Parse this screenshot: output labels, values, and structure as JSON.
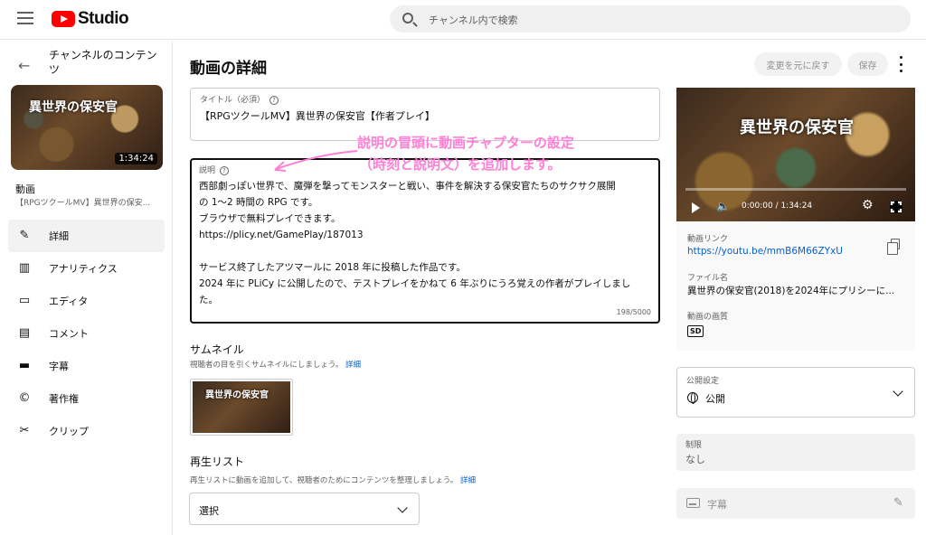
{
  "app": {
    "logo_text": "Studio"
  },
  "search": {
    "placeholder": "チャンネル内で検索"
  },
  "sidebar": {
    "title": "チャンネルのコンテンツ",
    "thumb_title": "異世界の保安官",
    "thumb_duration": "1:34:24",
    "video_label": "動画",
    "video_name": "【RPGツクールMV】異世界の保安...",
    "items": [
      {
        "label": "詳細",
        "icon": "pencil-icon",
        "glyph": "✎"
      },
      {
        "label": "アナリティクス",
        "icon": "analytics-icon",
        "glyph": "▥"
      },
      {
        "label": "エディタ",
        "icon": "editor-icon",
        "glyph": "▭"
      },
      {
        "label": "コメント",
        "icon": "comment-icon",
        "glyph": "▤"
      },
      {
        "label": "字幕",
        "icon": "subtitles-icon",
        "glyph": "▬"
      },
      {
        "label": "著作権",
        "icon": "copyright-icon",
        "glyph": "©"
      },
      {
        "label": "クリップ",
        "icon": "scissors-icon",
        "glyph": "✂"
      }
    ]
  },
  "header": {
    "title": "動画の詳細",
    "undo_label": "変更を元に戻す",
    "save_label": "保存"
  },
  "title_field": {
    "label": "タイトル（必須）",
    "value": "【RPGツクールMV】異世界の保安官【作者プレイ】"
  },
  "description": {
    "label": "説明",
    "lines": [
      "西部劇っぽい世界で、魔弾を撃ってモンスターと戦い、事件を解決する保安官たちのサクサク展開",
      "の 1〜2 時間の RPG です。",
      "ブラウザで無料プレイできます。",
      "https://plicy.net/GamePlay/187013",
      "",
      "サービス終了したアツマールに 2018 年に投稿した作品です。",
      "2024 年に PLiCy に公開したので、テストプレイをかねて 6 年ぶりにうろ覚えの作者がプレイしまし",
      "た。"
    ],
    "count": "198/5000"
  },
  "annotation": {
    "line1": "説明の冒頭に動画チャプターの設定",
    "line2": "（時刻と説明文）を追加します。",
    "color": "#ff80d5"
  },
  "thumbnail": {
    "title": "サムネイル",
    "subtitle": "視聴者の目を引くサムネイルにしましょう。",
    "link": "詳細",
    "image_title": "異世界の保安官"
  },
  "playlist": {
    "title": "再生リスト",
    "subtitle": "再生リストに動画を追加して、視聴者のためにコンテンツを整理しましょう。",
    "link": "詳細",
    "select_value": "選択"
  },
  "player": {
    "title": "異世界の保安官",
    "time": "0:00:00 / 1:34:24"
  },
  "video_info": {
    "link_label": "動画リンク",
    "link": "https://youtu.be/mmB6M66ZYxU",
    "file_label": "ファイル名",
    "file_name": "異世界の保安官(2018)を2024年にプリシーに...",
    "quality_label": "動画の画質",
    "quality_badge": "SD"
  },
  "visibility": {
    "label": "公開設定",
    "value": "公開"
  },
  "restrictions": {
    "label": "制限",
    "value": "なし"
  },
  "subtitles": {
    "label": "字幕"
  },
  "colors": {
    "link": "#065fd4",
    "brand": "#ff0000"
  }
}
